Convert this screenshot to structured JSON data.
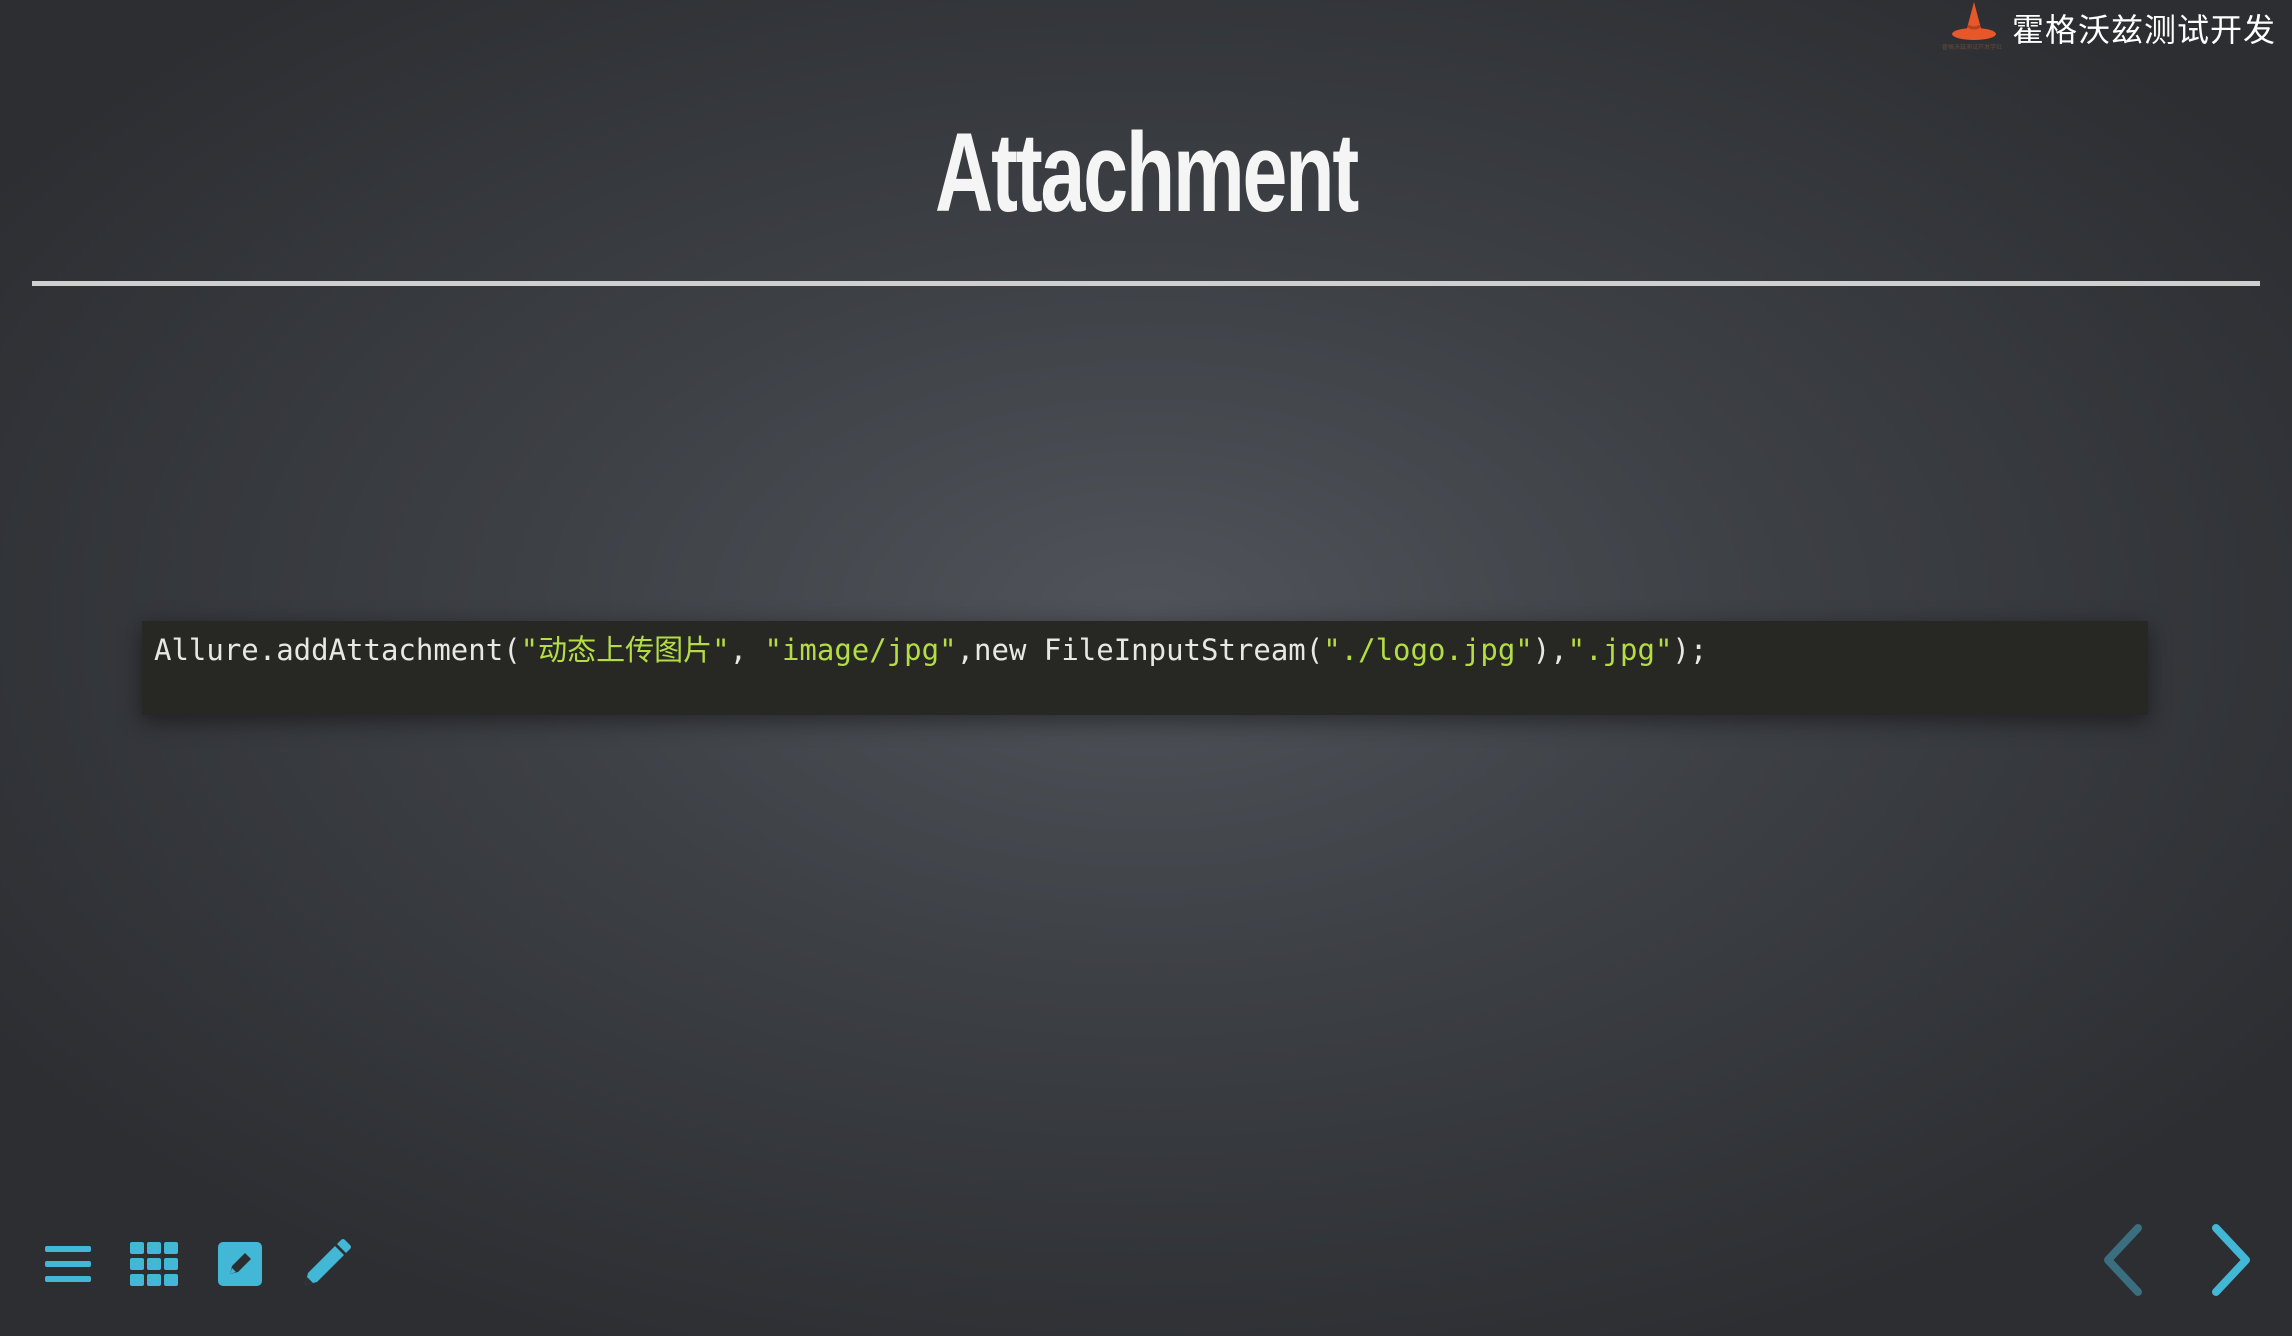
{
  "brand": {
    "name": "霍格沃兹测试开发",
    "tagline": "霍格沃兹测试开发学社"
  },
  "slide": {
    "title": "Attachment",
    "code": {
      "segments": [
        {
          "text": "Allure.addAttachment(",
          "kind": "plain"
        },
        {
          "text": "\"动态上传图片\"",
          "kind": "string"
        },
        {
          "text": ", ",
          "kind": "plain"
        },
        {
          "text": "\"image/jpg\"",
          "kind": "string"
        },
        {
          "text": ",new FileInputStream(",
          "kind": "plain"
        },
        {
          "text": "\"./logo.jpg\"",
          "kind": "string"
        },
        {
          "text": "),",
          "kind": "plain"
        },
        {
          "text": "\".jpg\"",
          "kind": "string"
        },
        {
          "text": ");",
          "kind": "plain"
        }
      ]
    }
  },
  "controls": {
    "left": [
      {
        "name": "menu-icon"
      },
      {
        "name": "grid-icon"
      },
      {
        "name": "edit-square-icon"
      },
      {
        "name": "pencil-icon"
      }
    ],
    "prev": {
      "name": "chevron-left-icon"
    },
    "next": {
      "name": "chevron-right-icon"
    }
  },
  "colors": {
    "accent": "#42b7d6",
    "accent_dim": "#3a6f80",
    "code_bg": "#272823",
    "code_text": "#e8e8e3",
    "code_string": "#b3dc45",
    "logo_orange": "#e8572a"
  }
}
